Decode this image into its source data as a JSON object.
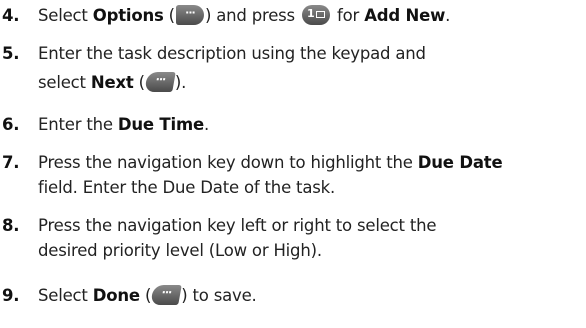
{
  "steps": [
    {
      "num": "4.",
      "parts": {
        "a": "Select ",
        "b": "Options",
        "c": " (",
        "d": ") and press ",
        "e": " for ",
        "f": "Add New",
        "g": "."
      }
    },
    {
      "num": "5.",
      "parts": {
        "a": "Enter the task description using the keypad and",
        "b": "select ",
        "c": "Next",
        "d": " (",
        "e": ")."
      }
    },
    {
      "num": "6.",
      "parts": {
        "a": "Enter the ",
        "b": "Due Time",
        "c": "."
      }
    },
    {
      "num": "7.",
      "parts": {
        "a": "Press the navigation key down to highlight the ",
        "b": "Due Date",
        "c": "field. Enter the Due Date of the task."
      }
    },
    {
      "num": "8.",
      "parts": {
        "a": "Press the navigation key left or right to select the",
        "b": "desired priority level (Low or High)."
      }
    },
    {
      "num": "9.",
      "parts": {
        "a": "Select ",
        "b": "Done",
        "c": " (",
        "d": ") to save."
      }
    }
  ],
  "icons": {
    "options_key": "right-soft-key-icon",
    "one_key": "one-key-icon",
    "next_key": "left-soft-key-icon",
    "done_key": "left-soft-key-icon",
    "dots": "···",
    "one_digit": "1"
  }
}
